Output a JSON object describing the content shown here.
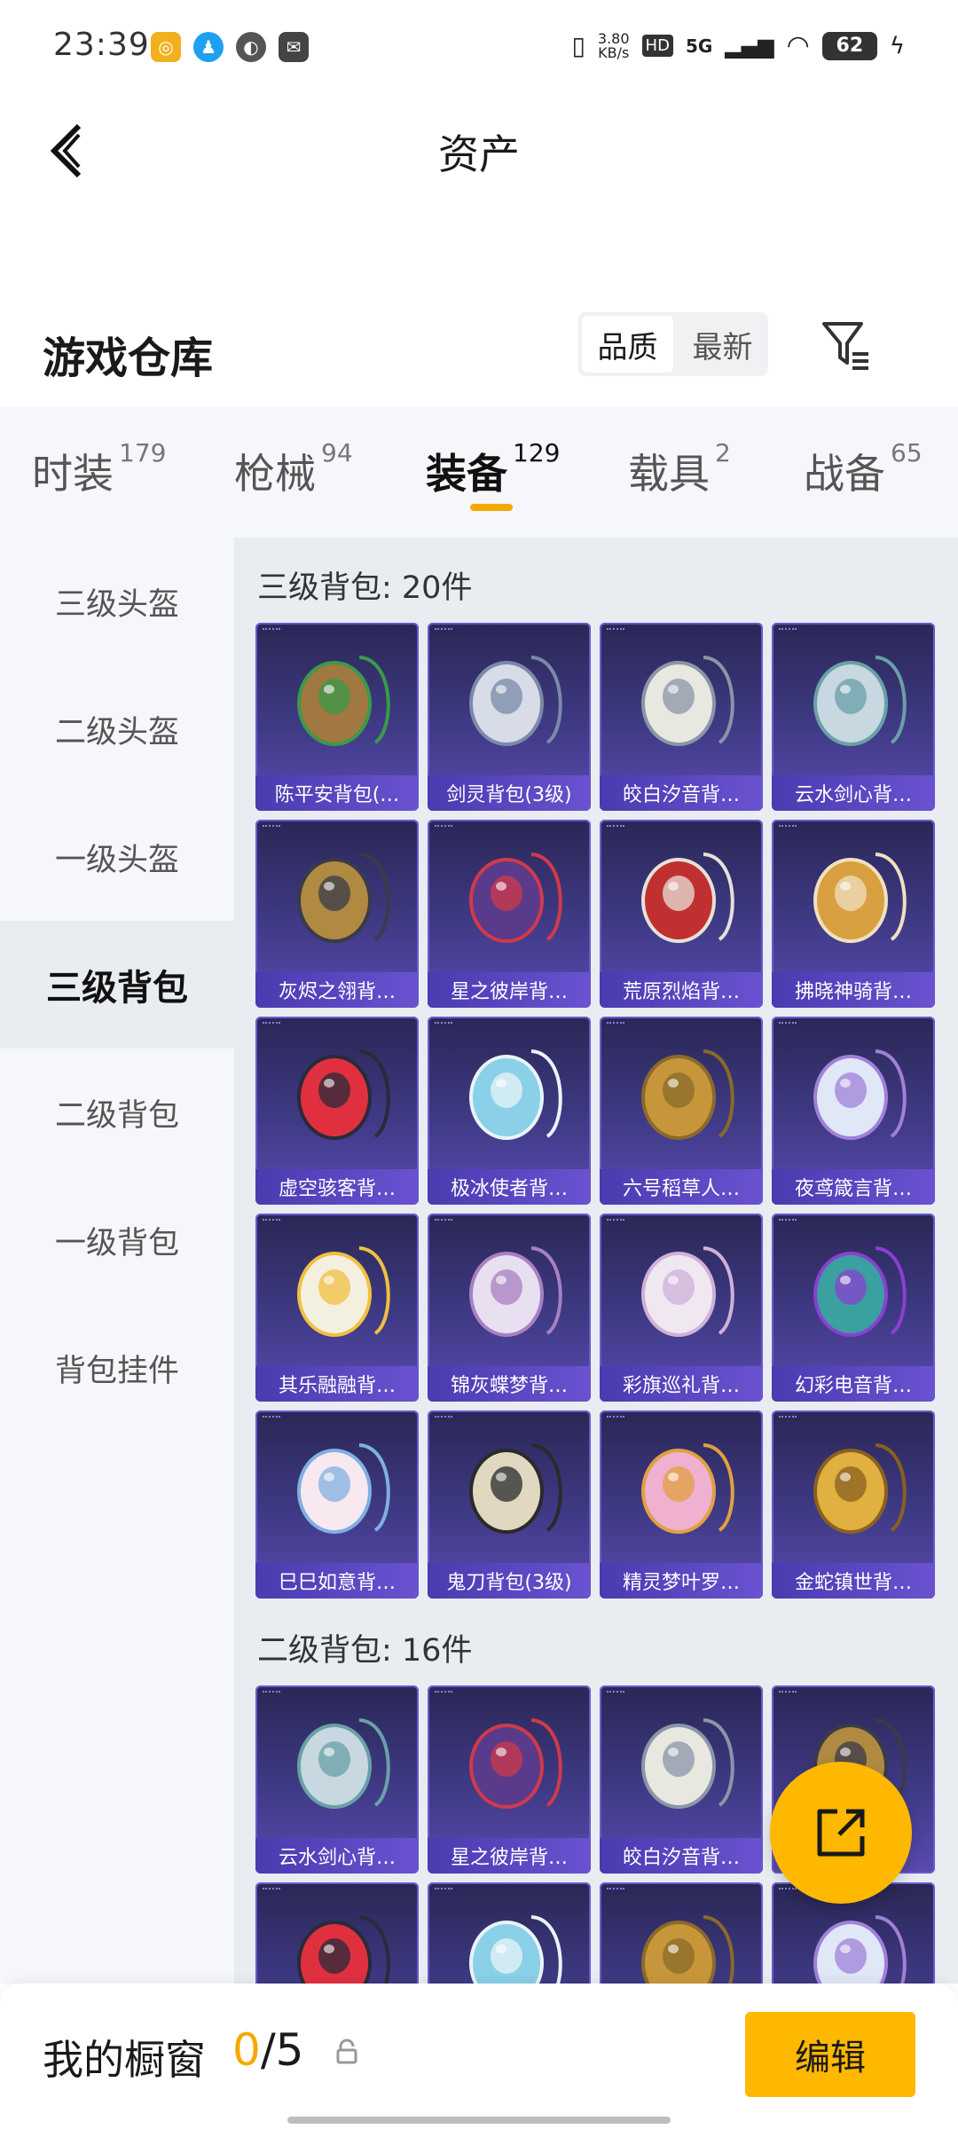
{
  "status": {
    "time": "23:39",
    "net_speed_value": "3.80",
    "net_speed_unit": "KB/s",
    "hd": "HD",
    "signal_type": "5G",
    "battery": "62"
  },
  "header": {
    "title": "资产"
  },
  "warehouse": {
    "title": "游戏仓库",
    "sort_options": [
      "品质",
      "最新"
    ],
    "active_sort": "品质"
  },
  "tabs": [
    {
      "label": "时装",
      "count": "179"
    },
    {
      "label": "枪械",
      "count": "94"
    },
    {
      "label": "装备",
      "count": "129"
    },
    {
      "label": "载具",
      "count": "2"
    },
    {
      "label": "战备",
      "count": "65"
    }
  ],
  "sidebar": [
    {
      "label": "三级头盔"
    },
    {
      "label": "二级头盔"
    },
    {
      "label": "一级头盔"
    },
    {
      "label": "三级背包"
    },
    {
      "label": "二级背包"
    },
    {
      "label": "一级背包"
    },
    {
      "label": "背包挂件"
    }
  ],
  "sections": [
    {
      "title": "三级背包: 20件",
      "items": [
        {
          "name": "陈平安背包(…",
          "icon": "basket-backpack"
        },
        {
          "name": "剑灵背包(3级)",
          "icon": "sword-spirit-backpack"
        },
        {
          "name": "皎白汐音背…",
          "icon": "shell-backpack"
        },
        {
          "name": "云水剑心背…",
          "icon": "sword-backpack"
        },
        {
          "name": "灰烬之翎背…",
          "icon": "ash-wing-backpack"
        },
        {
          "name": "星之彼岸背…",
          "icon": "astronaut-backpack"
        },
        {
          "name": "荒原烈焰背…",
          "icon": "flame-backpack"
        },
        {
          "name": "拂晓神骑背…",
          "icon": "golden-knight-backpack"
        },
        {
          "name": "虚空骇客背…",
          "icon": "void-hacker-backpack"
        },
        {
          "name": "极冰使者背…",
          "icon": "ice-crystal-backpack"
        },
        {
          "name": "六号稻草人…",
          "icon": "scarecrow-backpack"
        },
        {
          "name": "夜鸢箴言背…",
          "icon": "jellyfish-backpack"
        },
        {
          "name": "其乐融融背…",
          "icon": "bunny-backpack"
        },
        {
          "name": "锦灰蝶梦背…",
          "icon": "butterfly-backpack"
        },
        {
          "name": "彩旗巡礼背…",
          "icon": "bow-backpack"
        },
        {
          "name": "幻彩电音背…",
          "icon": "speaker-backpack"
        },
        {
          "name": "巳巳如意背…",
          "icon": "snake-plush-backpack"
        },
        {
          "name": "鬼刀背包(3级)",
          "icon": "ghost-blade-backpack"
        },
        {
          "name": "精灵梦叶罗…",
          "icon": "heart-backpack"
        },
        {
          "name": "金蛇镇世背…",
          "icon": "golden-snake-backpack"
        }
      ]
    },
    {
      "title": "二级背包: 16件",
      "items": [
        {
          "name": "云水剑心背…",
          "icon": "sword-backpack"
        },
        {
          "name": "星之彼岸背…",
          "icon": "astronaut-backpack"
        },
        {
          "name": "皎白汐音背…",
          "icon": "shell-backpack"
        },
        {
          "name": "",
          "icon": "ash-wing-backpack"
        },
        {
          "name": "",
          "icon": "void-hacker-backpack"
        },
        {
          "name": "",
          "icon": "ice-crystal-backpack"
        },
        {
          "name": "",
          "icon": "scarecrow-backpack"
        },
        {
          "name": "",
          "icon": "jellyfish-backpack"
        }
      ]
    }
  ],
  "showcase": {
    "label": "我的橱窗",
    "current": "0",
    "total": "/5",
    "edit_label": "编辑"
  },
  "colors": {
    "accent": "#ffb800",
    "card_top": "#2a2755",
    "card_bottom": "#5a4ab0",
    "label_bar": "#5a46c8"
  }
}
